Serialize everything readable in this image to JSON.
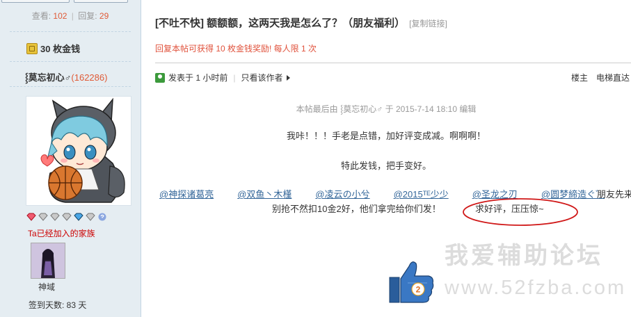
{
  "sidebar": {
    "stats": {
      "views_label": "查看:",
      "views": "102",
      "replies_label": "回复:",
      "replies": "29",
      "separator": "|"
    },
    "coins": "30 枚金钱",
    "username": "⸾莫忘初心♂",
    "uid": "(162286)",
    "family": "Ta已经加入的家族",
    "medal_name": "神域",
    "checkin": "签到天数: 83 天"
  },
  "post": {
    "title": "[不吐不快] 额额额，这两天我是怎么了？（朋友福利）",
    "copy_link": "[复制链接]",
    "reward": "回复本帖可获得 10 枚金钱奖励! 每人限 1 次",
    "posted_time": "发表于 1 小时前",
    "author_only": "只看该作者",
    "floor": "楼主",
    "elevator": "电梯直达",
    "last_edit": "本帖最后由 ⸾莫忘初心♂ 于 2015-7-14 18:10 编辑",
    "line1": "我咔！！！手老是点错，加好评变成减。啊啊啊！",
    "line2": "特此发钱，把手变好。",
    "mentions": [
      "@神探诸葛亮",
      "@双鱼丶木槿",
      "@凌云の小兮",
      "@2015ᵀᴱ少少",
      "@圣龙之刃",
      "@圆梦締造ぐ゛"
    ],
    "friends_text": "朋友先来",
    "line4": "别抢不然扣10金2好，他们拿完给你们发！",
    "highlight": "求好评，压压惊~",
    "like_count": "2"
  },
  "watermark": {
    "cn": "我爱辅助论坛",
    "url": "www.52fzba.com"
  },
  "colors": {
    "sidebar_bg": "#e5edf2",
    "accent": "#e05a36",
    "link": "#336699",
    "circle": "#d01818",
    "like_blue": "#2a5d9b"
  }
}
